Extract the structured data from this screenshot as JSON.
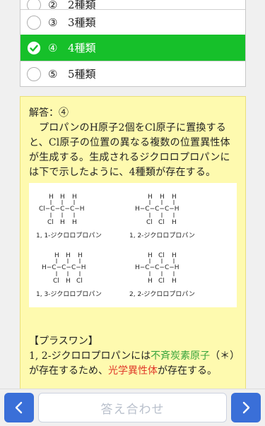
{
  "options": [
    {
      "num": "②",
      "label": "2種類",
      "selected": false
    },
    {
      "num": "③",
      "label": "3種類",
      "selected": false
    },
    {
      "num": "④",
      "label": "4種類",
      "selected": true
    },
    {
      "num": "⑤",
      "label": "5種類",
      "selected": false
    }
  ],
  "answer": {
    "heading": "解答：④",
    "body": "プロパンのH原子2個をCl原子に置換すると、Cl原子の位置の異なる複数の位置異性体が生成する。生成されるジクロロプロパンには下で示したように、4種類が存在する。",
    "structures": [
      {
        "name": "1, 1-ジクロロプロパン"
      },
      {
        "name": "1, 2-ジクロロプロパン"
      },
      {
        "name": "1, 3-ジクロロプロパン"
      },
      {
        "name": "2, 2-ジクロロプロパン"
      }
    ],
    "plus_heading": "【プラスワン】",
    "plus_text_1": "1, 2-ジクロロプロパンには",
    "plus_highlight_1": "不斉炭素原子",
    "plus_text_2": "（＊）が存在するため、",
    "plus_highlight_2": "光学異性体",
    "plus_text_3": "が存在する。"
  },
  "footer": {
    "check_label": "答え合わせ"
  },
  "colors": {
    "selected_bg": "#16c02a",
    "answer_bg": "#fefaaf",
    "nav_button": "#3a6fd8",
    "highlight_green": "#39a53e",
    "highlight_red": "#e03a2a"
  }
}
